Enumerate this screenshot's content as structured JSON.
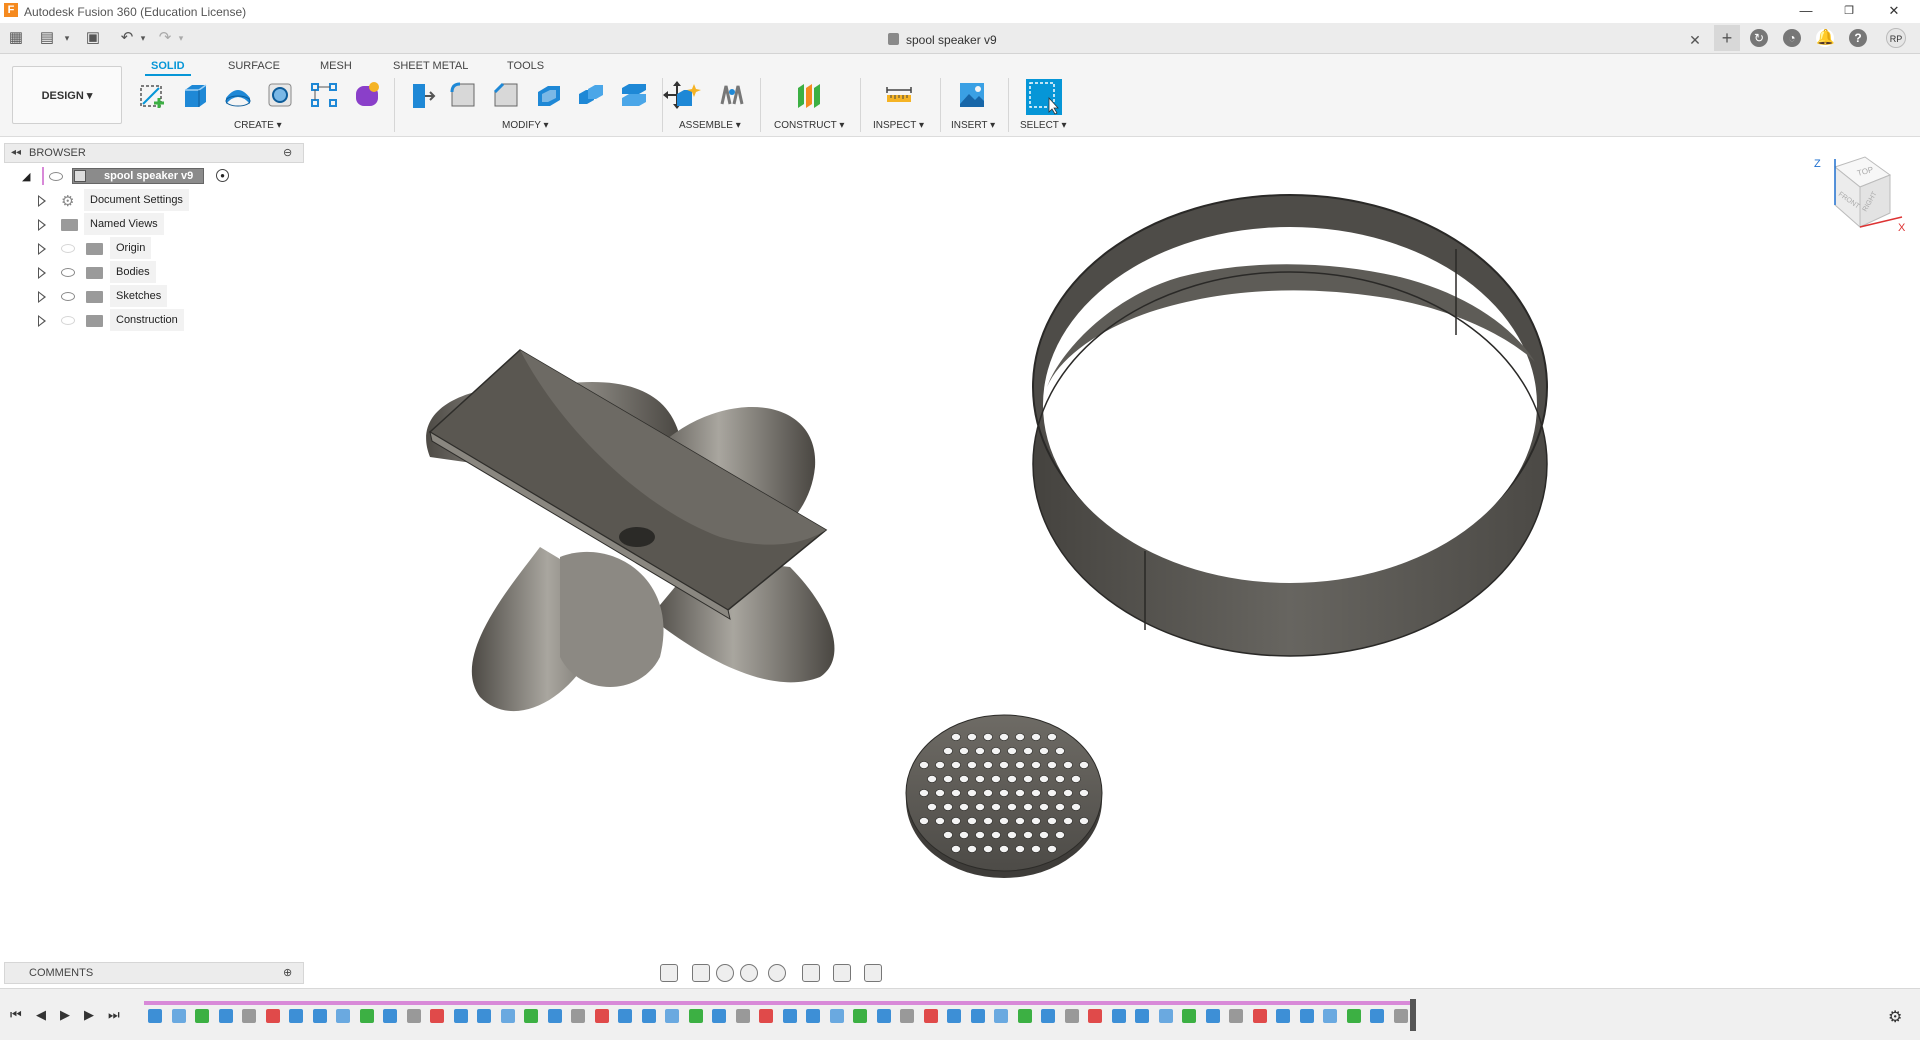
{
  "app": {
    "window_title": "Autodesk Fusion 360 (Education License)",
    "logo_letter": "F"
  },
  "document": {
    "tab_title": "spool speaker v9",
    "user_initials": "RP"
  },
  "workspace": {
    "label": "DESIGN ▾"
  },
  "toolbar": {
    "tabs": [
      "SOLID",
      "SURFACE",
      "MESH",
      "SHEET METAL",
      "TOOLS"
    ],
    "active_tab": "SOLID",
    "groups": [
      "CREATE ▾",
      "MODIFY ▾",
      "ASSEMBLE ▾",
      "CONSTRUCT ▾",
      "INSPECT ▾",
      "INSERT ▾",
      "SELECT ▾"
    ]
  },
  "browser": {
    "header": "BROWSER",
    "root": "spool speaker v9",
    "items": [
      {
        "label": "Document Settings",
        "icon": "gear-icon",
        "eye": "none"
      },
      {
        "label": "Named Views",
        "icon": "folder-icon",
        "eye": "none"
      },
      {
        "label": "Origin",
        "icon": "folder-icon",
        "eye": "hidden"
      },
      {
        "label": "Bodies",
        "icon": "folder-icon",
        "eye": "visible"
      },
      {
        "label": "Sketches",
        "icon": "folder-icon",
        "eye": "visible"
      },
      {
        "label": "Construction",
        "icon": "folder-icon",
        "eye": "hidden"
      }
    ]
  },
  "viewcube": {
    "top": "TOP",
    "front": "FRONT",
    "right": "RIGHT",
    "axis_z": "Z",
    "axis_x": "X"
  },
  "comments": {
    "label": "COMMENTS"
  },
  "colors": {
    "accent": "#0696d7",
    "timeline": "#d889d8",
    "model": "#5a5751"
  }
}
